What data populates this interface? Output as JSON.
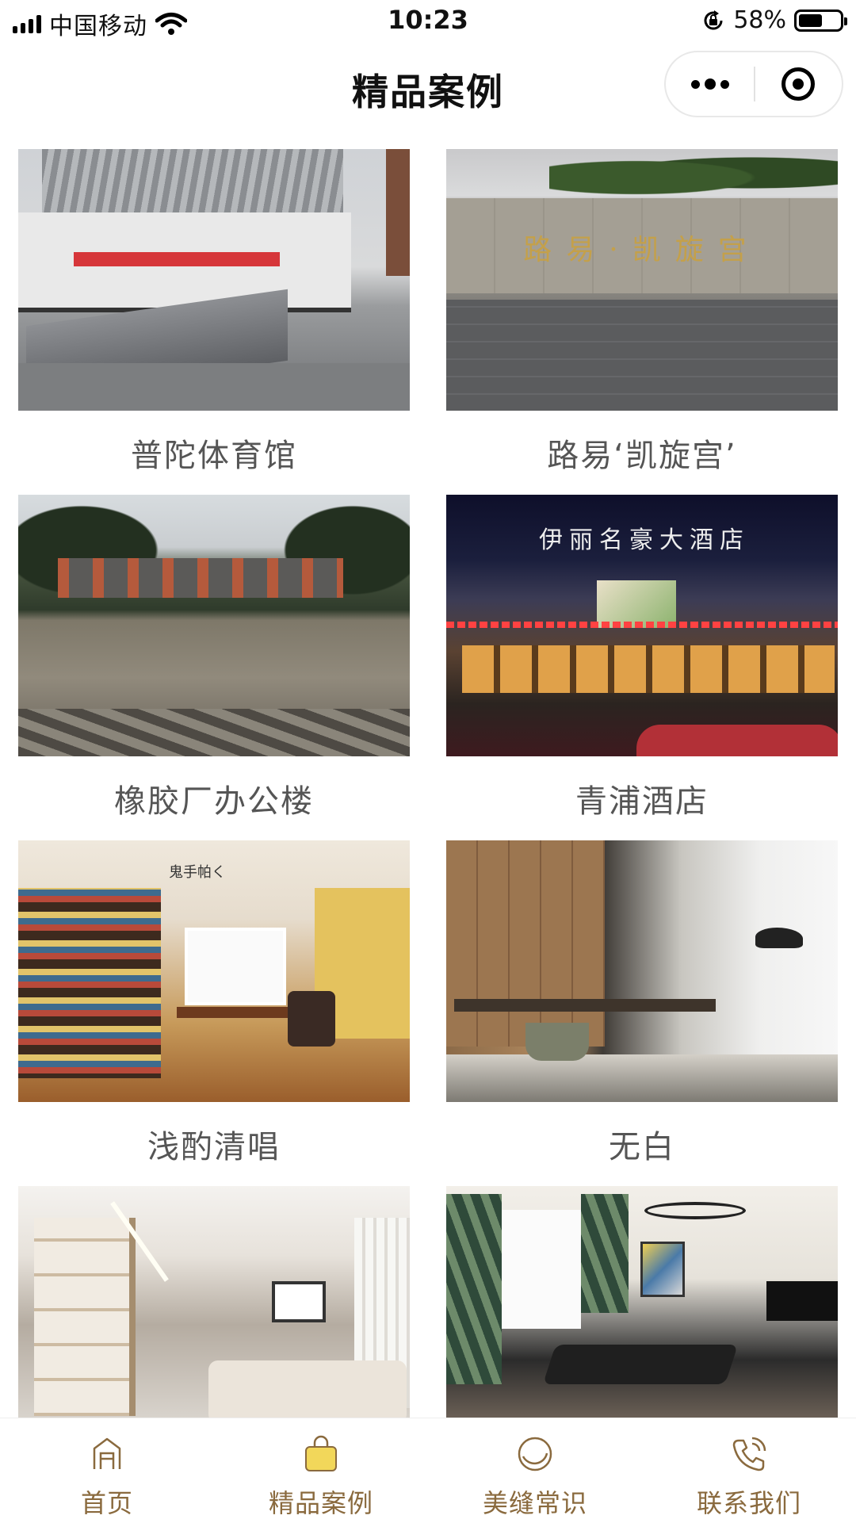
{
  "status_bar": {
    "carrier": "中国移动",
    "time": "10:23",
    "battery_percent_text": "58%",
    "battery_level": 0.58
  },
  "nav": {
    "title": "精品案例"
  },
  "cases": [
    {
      "title": "普陀体育馆"
    },
    {
      "title": "路易‘凯旋宫’",
      "image_text": "路易·凯旋宫"
    },
    {
      "title": "橡胶厂办公楼"
    },
    {
      "title": "青浦酒店",
      "image_text": "伊丽名豪大酒店"
    },
    {
      "title": "浅酌清唱",
      "image_text": "鬼手帕く"
    },
    {
      "title": "无白"
    },
    {
      "title": ""
    },
    {
      "title": ""
    }
  ],
  "tabbar": {
    "items": [
      {
        "label": "首页",
        "icon": "home-icon"
      },
      {
        "label": "精品案例",
        "icon": "bag-icon",
        "active": true
      },
      {
        "label": "美缝常识",
        "icon": "ring-icon"
      },
      {
        "label": "联系我们",
        "icon": "phone-icon"
      }
    ],
    "colors": {
      "label": "#8a6a3e",
      "icon": "#8a6a3e",
      "active_icon_fill": "#f2d75a"
    }
  }
}
